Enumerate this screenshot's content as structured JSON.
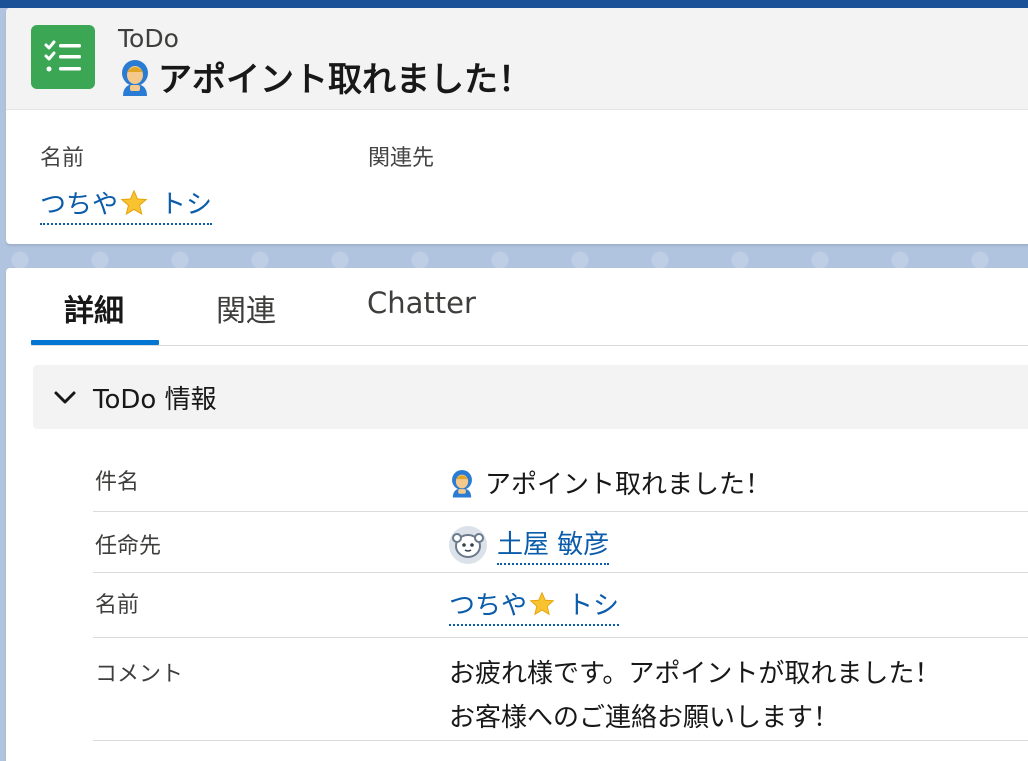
{
  "record": {
    "object_name": "ToDo",
    "title": "アポイント取れました！",
    "icon": "task-list-icon",
    "icon_color": "#3ba755"
  },
  "highlights": {
    "name_label": "名前",
    "name_value_part1": "つちや",
    "name_value_part2": "トシ",
    "related_label": "関連先"
  },
  "tabs": [
    {
      "label": "詳細",
      "active": true
    },
    {
      "label": "関連",
      "active": false
    },
    {
      "label": "Chatter",
      "active": false
    }
  ],
  "section": {
    "title": "ToDo 情報",
    "rows": [
      {
        "label": "件名",
        "value": "アポイント取れました！"
      },
      {
        "label": "任命先",
        "value": "土屋 敏彦"
      },
      {
        "label": "名前",
        "value_part1": "つちや",
        "value_part2": "トシ"
      },
      {
        "label": "コメント",
        "lines": [
          "お疲れ様です。アポイントが取れました！",
          "お客様へのご連絡お願いします！"
        ]
      }
    ]
  },
  "colors": {
    "link": "#0b5cab",
    "active_tab": "#0176d3",
    "top_bar": "#1b5297"
  }
}
